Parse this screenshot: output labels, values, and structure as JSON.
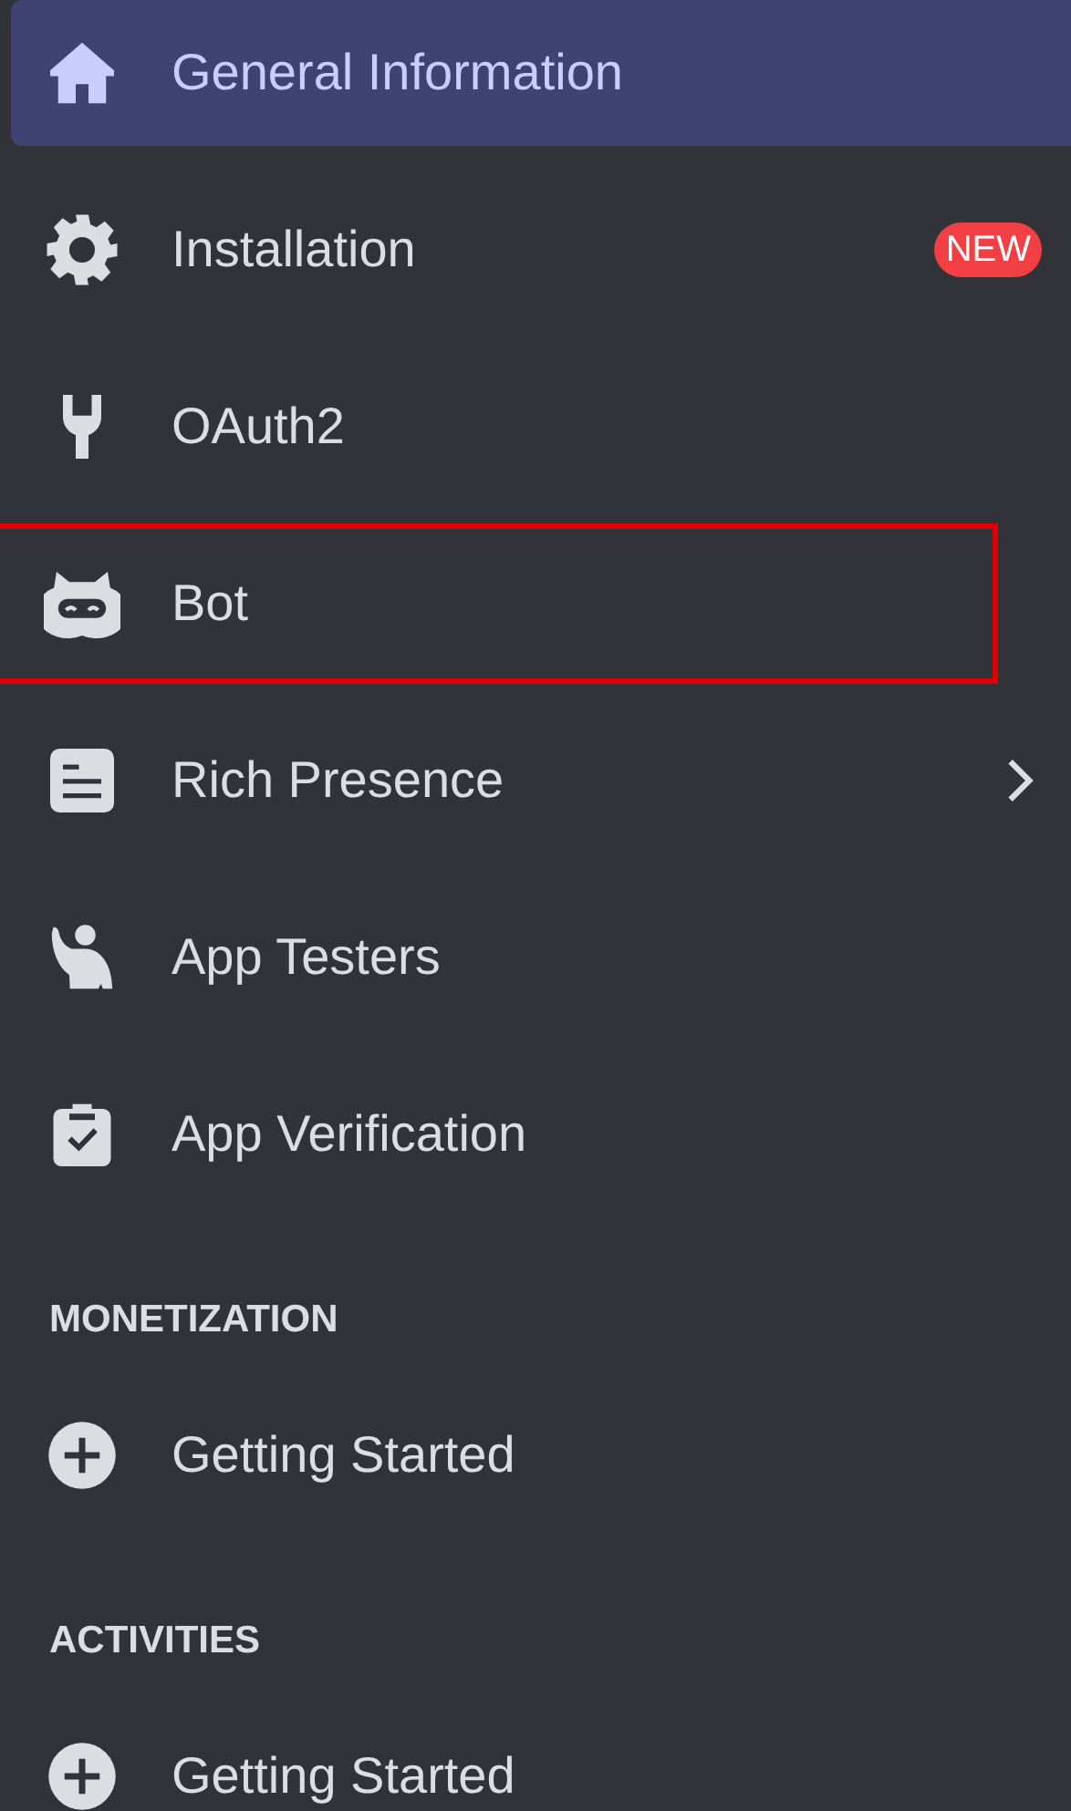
{
  "sections": [
    {
      "items": [
        {
          "label": "General Information",
          "selected": true,
          "outlined": false
        },
        {
          "label": "Installation",
          "selected": false,
          "outlined": false,
          "badge": "NEW"
        },
        {
          "label": "OAuth2",
          "selected": false,
          "outlined": false
        },
        {
          "label": "Bot",
          "selected": false,
          "outlined": true
        },
        {
          "label": "Rich Presence",
          "selected": false,
          "outlined": false,
          "expandable": true
        },
        {
          "label": "App Testers",
          "selected": false,
          "outlined": false
        },
        {
          "label": "App Verification",
          "selected": false,
          "outlined": false
        }
      ]
    },
    {
      "header": "MONETIZATION",
      "items": [
        {
          "label": "Getting Started",
          "selected": false,
          "outlined": false
        }
      ]
    },
    {
      "header": "ACTIVITIES",
      "items": [
        {
          "label": "Getting Started",
          "selected": false,
          "outlined": false
        }
      ]
    }
  ]
}
